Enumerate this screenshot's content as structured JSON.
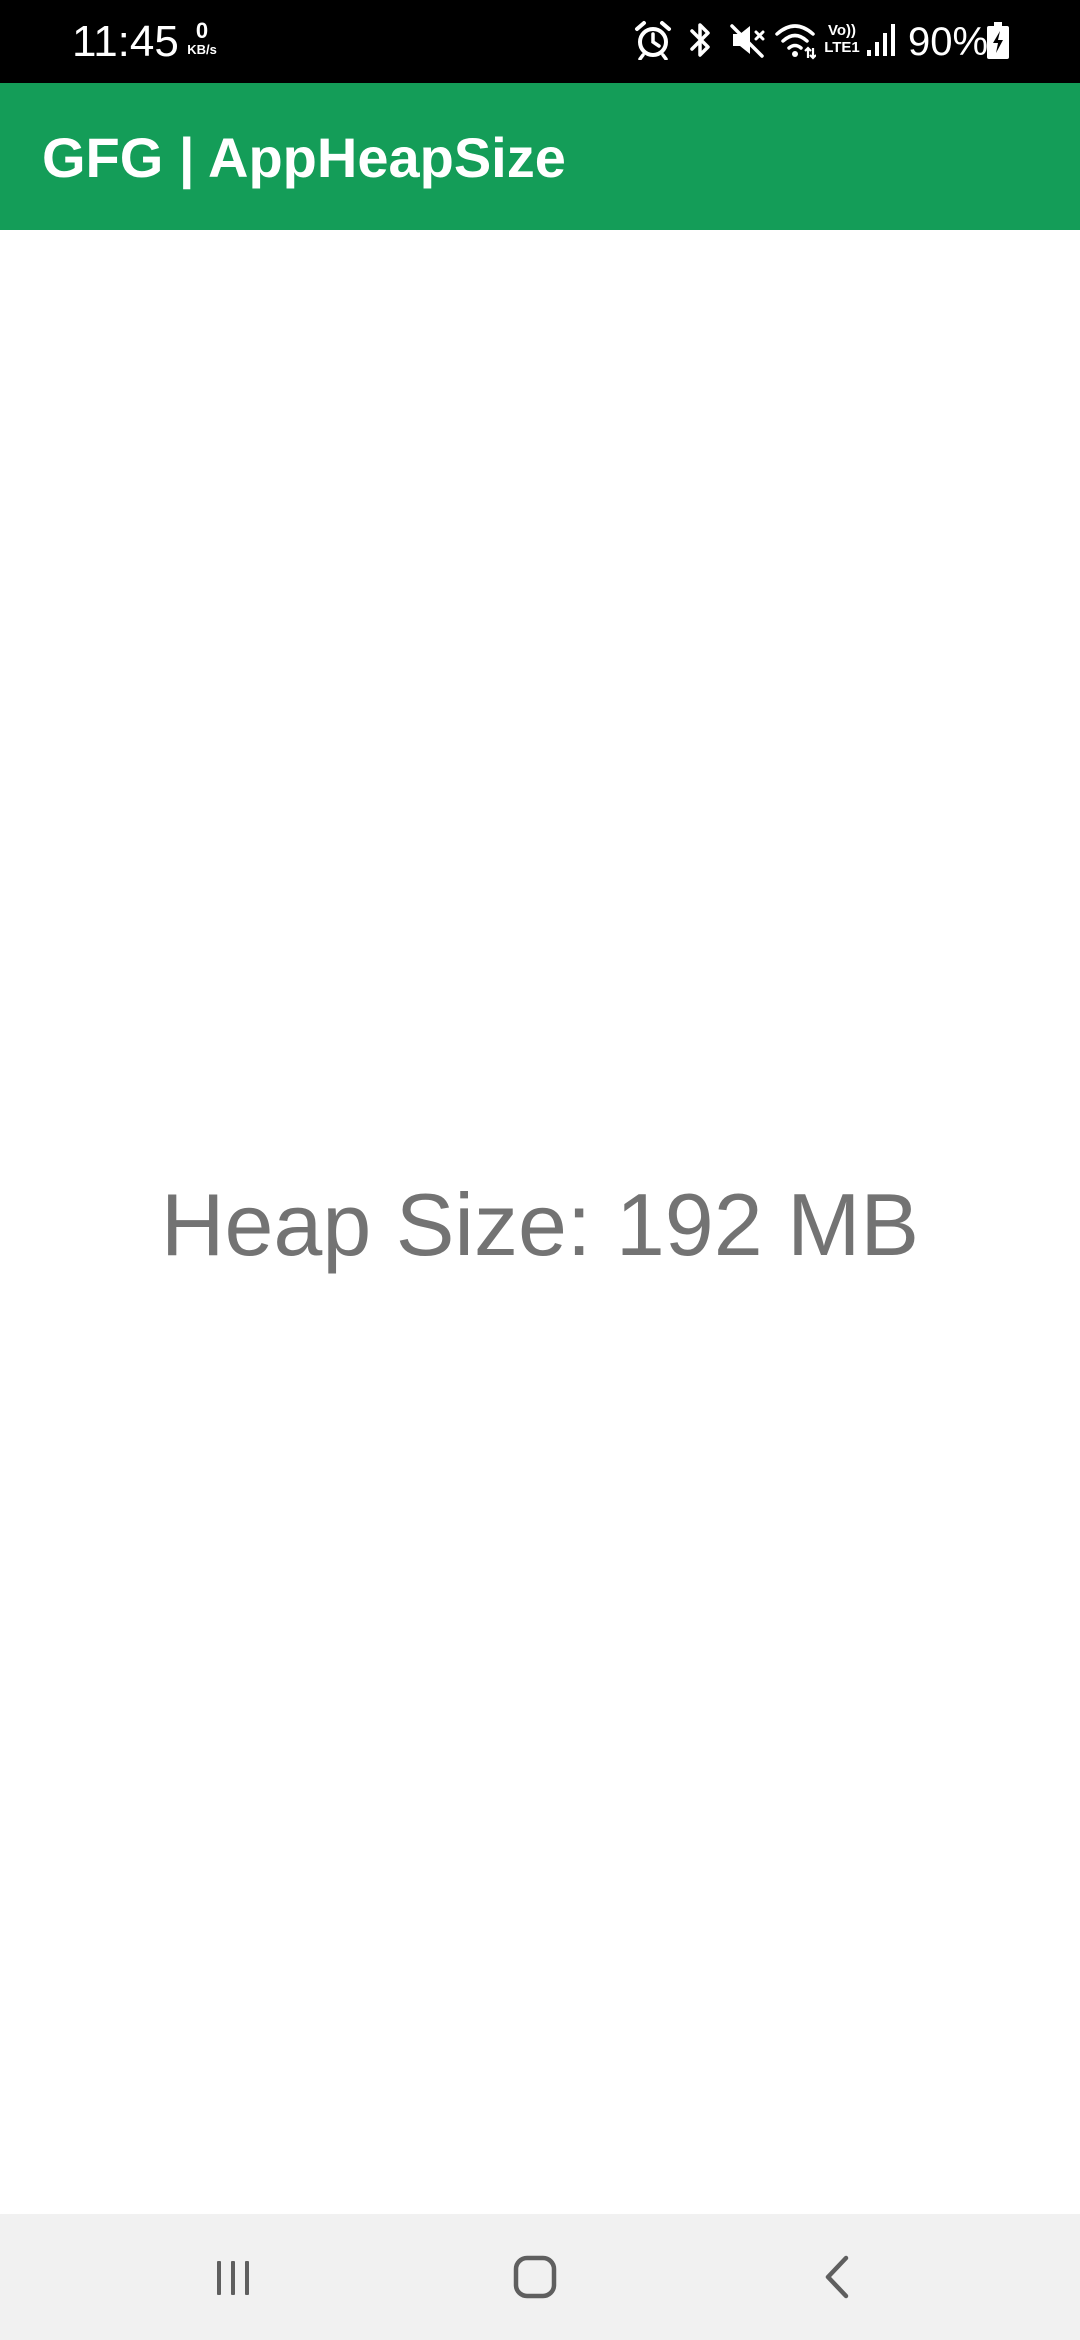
{
  "status_bar": {
    "time": "11:45",
    "net_speed_value": "0",
    "net_speed_unit": "KB/s",
    "battery_percent": "90%",
    "icons": [
      "alarm-icon",
      "bluetooth-icon",
      "mute-icon",
      "wifi-icon",
      "volte-icon",
      "signal-icon",
      "battery-charging-icon"
    ],
    "volte_label_top": "Vo))",
    "volte_label_bottom": "LTE1"
  },
  "app_bar": {
    "title": "GFG | AppHeapSize",
    "color": "#149d58"
  },
  "main": {
    "heap_text": "Heap Size: 192 MB",
    "text_color": "#737373"
  },
  "nav_bar": {
    "buttons": [
      "recent-apps-button",
      "home-button",
      "back-button"
    ]
  }
}
